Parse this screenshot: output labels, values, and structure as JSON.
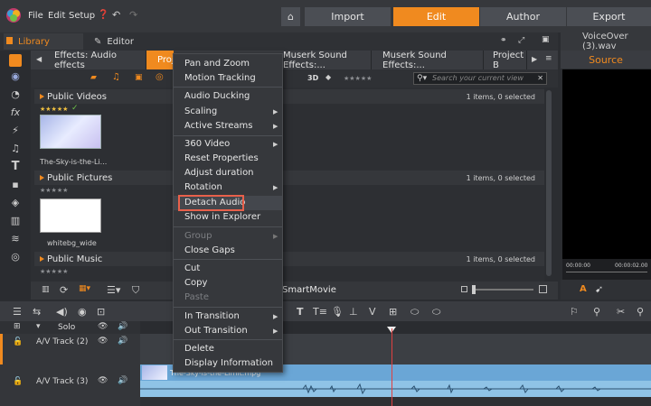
{
  "menubar": {
    "file": "File",
    "edit": "Edit",
    "setup": "Setup"
  },
  "modes": {
    "import": "Import",
    "edit": "Edit",
    "author": "Author",
    "export": "Export"
  },
  "library_tabs": {
    "library": "Library",
    "editor": "Editor"
  },
  "browser_tabs": [
    "Effects: Audio effects",
    "Proj",
    "Muserk Sound Effects:...",
    "Muserk Sound Effects:...",
    "Project B"
  ],
  "toolbar": {
    "threed": "3D",
    "search_placeholder": "Search your current view"
  },
  "sections": [
    {
      "title": "Public Videos",
      "count": "1 items, 0 selected"
    },
    {
      "title": "Public Pictures",
      "count": "1 items, 0 selected"
    },
    {
      "title": "Public Music",
      "count": "1 items, 0 selected"
    }
  ],
  "items": {
    "video_caption": "The-Sky-is-the-Li...",
    "picture_caption": "whitebg_wide"
  },
  "footer": {
    "smartmovie": "SmartMovie"
  },
  "preview": {
    "filename": "VoiceOver (3).wav",
    "source_label": "Source",
    "time_start": "00:00:00",
    "time_end": "00:00:02.00"
  },
  "timeline": {
    "solo": "Solo",
    "track2": "A/V Track (2)",
    "track3": "A/V Track (3)",
    "clip_title": "The-Sky-is-the-Limit.mpg"
  },
  "context_menu": {
    "items": [
      {
        "label": "Pan and Zoom"
      },
      {
        "label": "Motion Tracking"
      },
      {
        "label": "Audio Ducking"
      },
      {
        "label": "Scaling",
        "submenu": true
      },
      {
        "label": "Active Streams",
        "submenu": true
      },
      {
        "label": "360 Video",
        "submenu": true
      },
      {
        "label": "Reset Properties"
      },
      {
        "label": "Adjust duration"
      },
      {
        "label": "Rotation",
        "submenu": true
      },
      {
        "label": "Detach Audio",
        "highlighted": true
      },
      {
        "label": "Show in Explorer"
      },
      {
        "label": "Group",
        "submenu": true,
        "disabled": true
      },
      {
        "label": "Close Gaps"
      },
      {
        "label": "Cut"
      },
      {
        "label": "Copy"
      },
      {
        "label": "Paste",
        "disabled": true
      },
      {
        "label": "In Transition",
        "submenu": true
      },
      {
        "label": "Out Transition",
        "submenu": true
      },
      {
        "label": "Delete"
      },
      {
        "label": "Display Information"
      }
    ]
  },
  "colors": {
    "accent": "#f08a1f",
    "highlight_border": "#e8604b",
    "clip": "#8fc3e6"
  }
}
